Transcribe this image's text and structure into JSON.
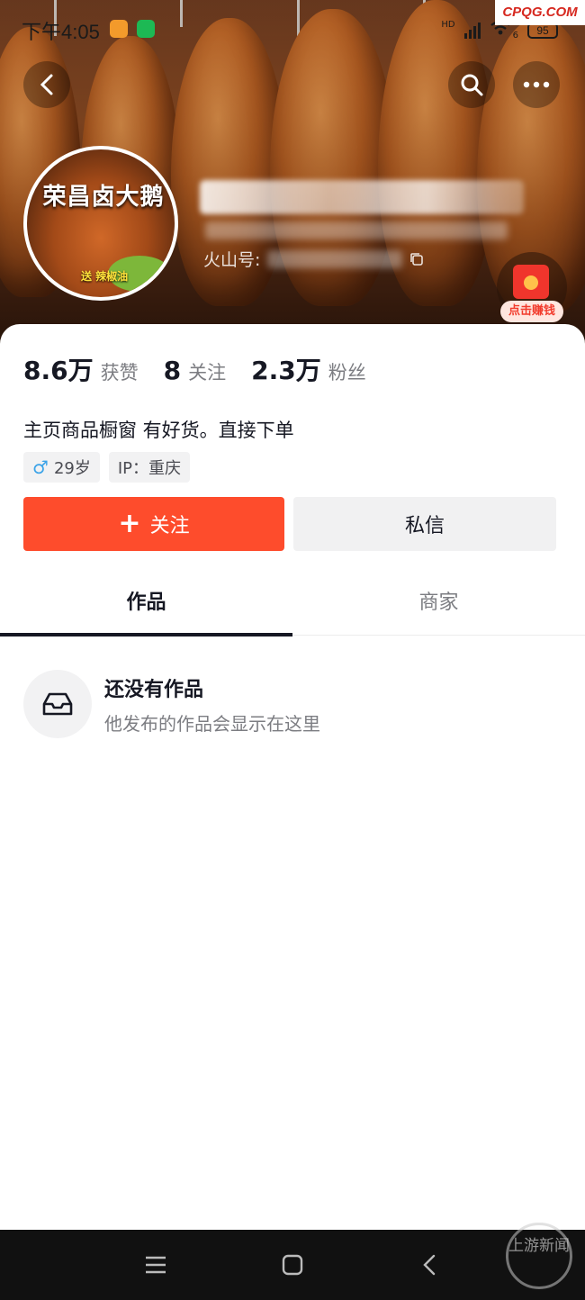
{
  "status_bar": {
    "time": "下午4:05",
    "network": "HD",
    "wifi_badge": "6",
    "battery": "95"
  },
  "watermark_top": "CPQG.COM",
  "watermark_bottom": "上游新闻",
  "profile": {
    "avatar_text": "荣昌卤大鹅",
    "avatar_tag": "送 辣椒油",
    "huoshan_label": "火山号:",
    "redpacket_label": "点击赚钱"
  },
  "stats": [
    {
      "num": "8.6万",
      "label": "获赞"
    },
    {
      "num": "8",
      "label": "关注"
    },
    {
      "num": "2.3万",
      "label": "粉丝"
    }
  ],
  "bio": "主页商品橱窗 有好货。直接下单",
  "tags": {
    "age": "29岁",
    "ip": "IP：重庆"
  },
  "buttons": {
    "follow": "关注",
    "message": "私信"
  },
  "tabs": [
    {
      "label": "作品"
    },
    {
      "label": "商家"
    }
  ],
  "empty_state": {
    "title": "还没有作品",
    "subtitle": "他发布的作品会显示在这里"
  },
  "colors": {
    "accent": "#fe4c2c",
    "text": "#161823",
    "muted": "#7c7d82"
  }
}
